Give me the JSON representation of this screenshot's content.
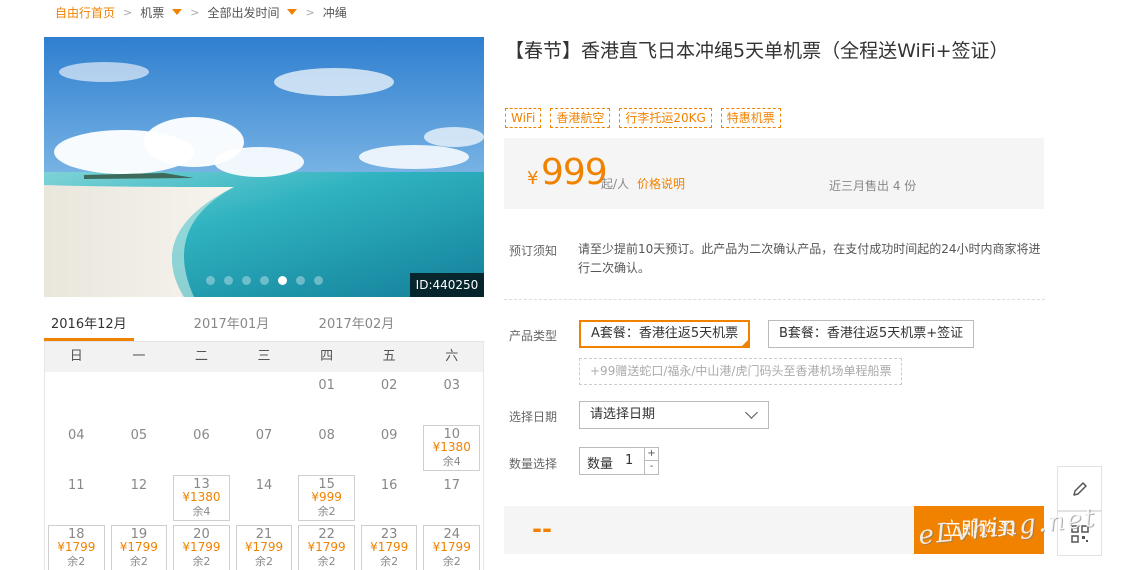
{
  "breadcrumb": {
    "home": "自由行首页",
    "items": [
      "机票",
      "全部出发时间",
      "冲绳"
    ]
  },
  "hero": {
    "id_label": "ID:440250",
    "dots_total": 7,
    "active_dot": 5
  },
  "calendar": {
    "months": [
      "2016年12月",
      "2017年01月",
      "2017年02月"
    ],
    "weekdays": [
      "日",
      "一",
      "二",
      "三",
      "四",
      "五",
      "六"
    ],
    "rows": [
      [
        {
          "d": ""
        },
        {
          "d": ""
        },
        {
          "d": ""
        },
        {
          "d": ""
        },
        {
          "d": "01"
        },
        {
          "d": "02"
        },
        {
          "d": "03"
        }
      ],
      [
        {
          "d": "04"
        },
        {
          "d": "05"
        },
        {
          "d": "06"
        },
        {
          "d": "07"
        },
        {
          "d": "08"
        },
        {
          "d": "09"
        },
        {
          "d": "10",
          "price": "¥1380",
          "remain": "余4"
        }
      ],
      [
        {
          "d": "11"
        },
        {
          "d": "12"
        },
        {
          "d": "13",
          "price": "¥1380",
          "remain": "余4"
        },
        {
          "d": "14"
        },
        {
          "d": "15",
          "price": "¥999",
          "remain": "余2"
        },
        {
          "d": "16"
        },
        {
          "d": "17"
        }
      ],
      [
        {
          "d": "18",
          "price": "¥1799",
          "remain": "余2"
        },
        {
          "d": "19",
          "price": "¥1799",
          "remain": "余2"
        },
        {
          "d": "20",
          "price": "¥1799",
          "remain": "余2"
        },
        {
          "d": "21",
          "price": "¥1799",
          "remain": "余2"
        },
        {
          "d": "22",
          "price": "¥1799",
          "remain": "余2"
        },
        {
          "d": "23",
          "price": "¥1799",
          "remain": "余2"
        },
        {
          "d": "24",
          "price": "¥1799",
          "remain": "余2"
        }
      ]
    ]
  },
  "product": {
    "title": "【春节】香港直飞日本冲绳5天单机票（全程送WiFi+签证）",
    "tags": [
      "WiFi",
      "香港航空",
      "行李托运20KG",
      "特惠机票"
    ],
    "currency": "¥",
    "price": "999",
    "per": "起/人",
    "price_explain": "价格说明",
    "sold": "近三月售出 4 份"
  },
  "booking": {
    "notice_label": "预订须知",
    "notice_text": "请至少提前10天预订。此产品为二次确认产品，在支付成功时间起的24小时内商家将进行二次确认。",
    "type_label": "产品类型",
    "option_a": "A套餐：香港往返5天机票",
    "option_b": "B套餐：香港往返5天机票+签证",
    "option_extra": "+99赠送蛇口/福永/中山港/虎门码头至香港机场单程船票",
    "date_label": "选择日期",
    "date_placeholder": "请选择日期",
    "qty_label": "数量选择",
    "qty_text": "数量",
    "qty_value": "1",
    "qty_plus": "+",
    "qty_minus": "-",
    "total": "--",
    "buy_button": "立即购买"
  },
  "watermark": "eLvhing.net",
  "colors": {
    "accent": "#f08200"
  }
}
